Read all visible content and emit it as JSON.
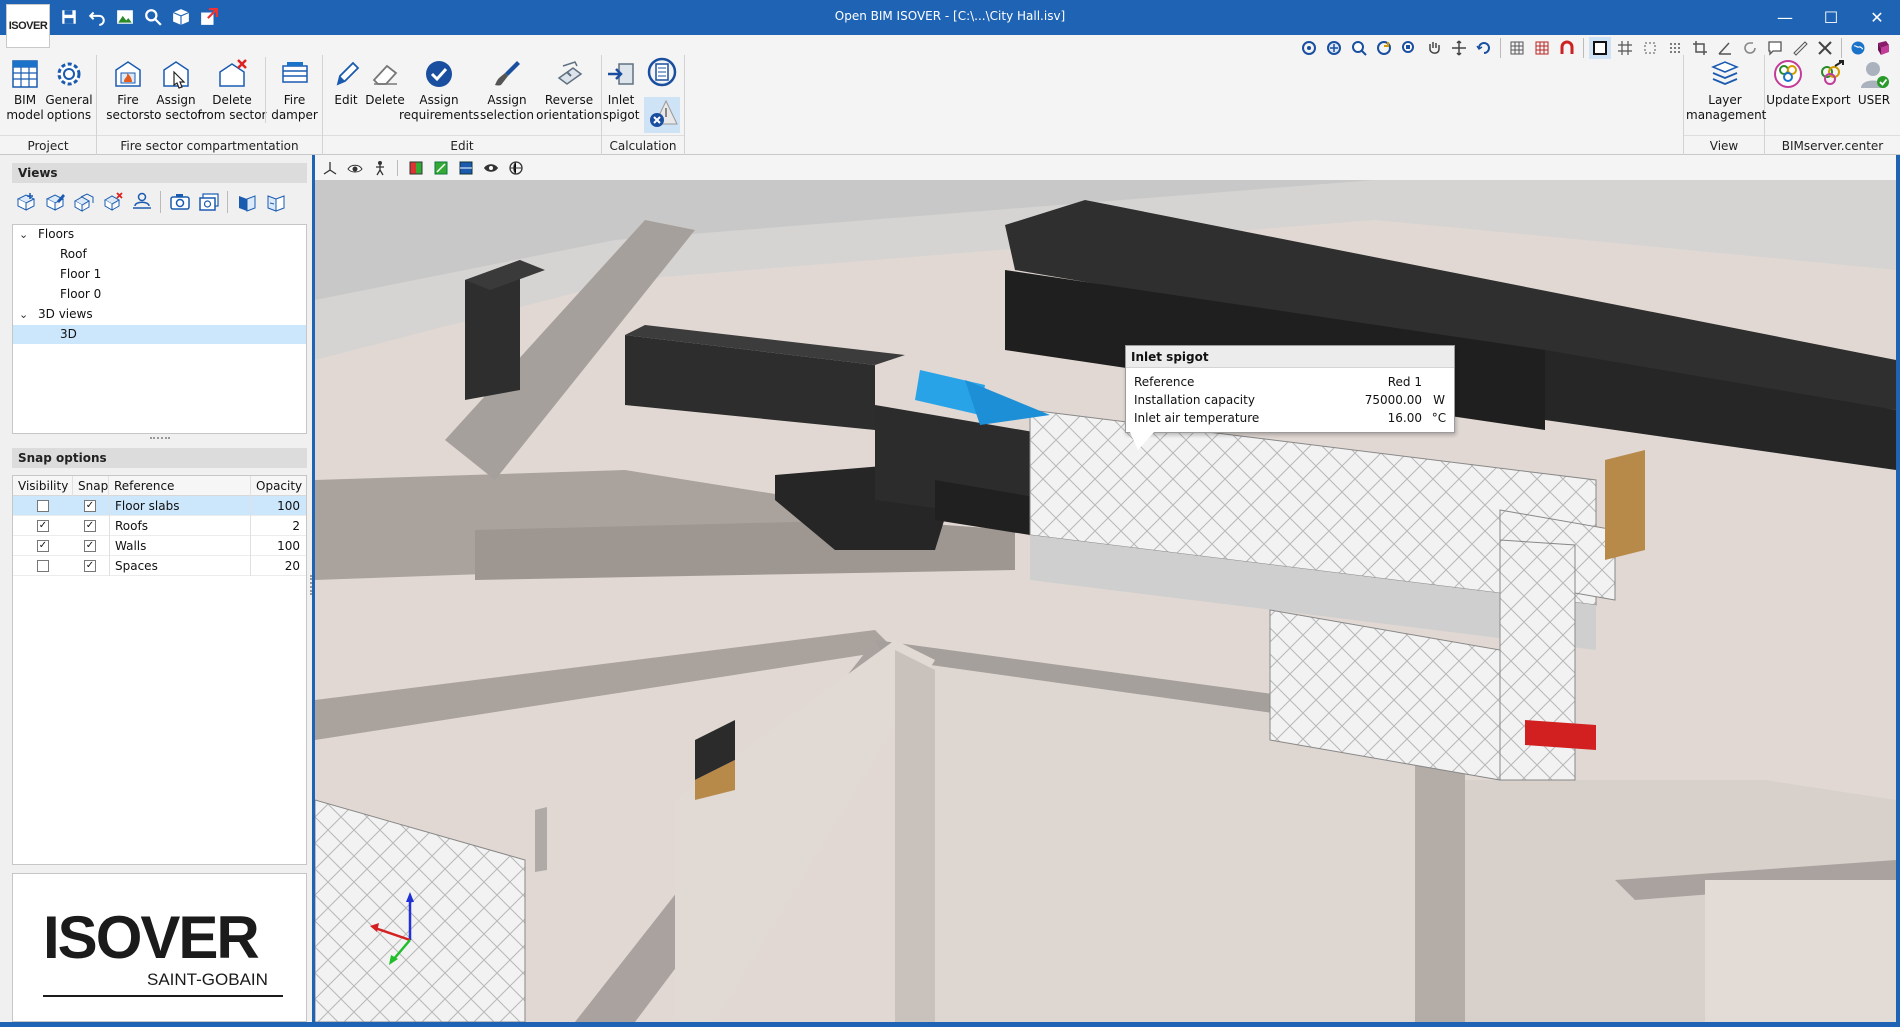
{
  "app": {
    "logo_text": "ISOVER",
    "window_title": "Open BIM ISOVER - [C:\\...\\City Hall.isv]"
  },
  "window_controls": {
    "minimize": "—",
    "maximize": "☐",
    "close": "✕"
  },
  "ribbon": {
    "groups": {
      "project": {
        "label": "Project",
        "bim_model_l1": "BIM",
        "bim_model_l2": "model",
        "general_l1": "General",
        "general_l2": "options"
      },
      "fire": {
        "label": "Fire sector compartmentation",
        "fire_sectors_l1": "Fire",
        "fire_sectors_l2": "sectors",
        "assign_sector_l1": "Assign",
        "assign_sector_l2": "to sector",
        "delete_sector_l1": "Delete",
        "delete_sector_l2": "from sector",
        "fire_damper_l1": "Fire",
        "fire_damper_l2": "damper"
      },
      "edit": {
        "label": "Edit",
        "edit": "Edit",
        "delete": "Delete",
        "assign_req_l1": "Assign",
        "assign_req_l2": "requirements",
        "assign_sel_l1": "Assign",
        "assign_sel_l2": "selection",
        "reverse_l1": "Reverse",
        "reverse_l2": "orientation"
      },
      "calculation": {
        "label": "Calculation",
        "inlet_l1": "Inlet",
        "inlet_l2": "spigot"
      },
      "view": {
        "label": "View",
        "layer_l1": "Layer",
        "layer_l2": "management"
      },
      "bimserver": {
        "label": "BIMserver.center",
        "update": "Update",
        "export": "Export",
        "user": "USER"
      }
    }
  },
  "views_panel": {
    "title": "Views",
    "tree": [
      {
        "label": "Floors",
        "caret": "⌄"
      },
      {
        "label": "Roof"
      },
      {
        "label": "Floor 1"
      },
      {
        "label": "Floor 0"
      },
      {
        "label": "3D views",
        "caret": "⌄"
      },
      {
        "label": "3D"
      }
    ]
  },
  "snap_panel": {
    "title": "Snap options",
    "headers": {
      "visibility": "Visibility",
      "snap": "Snap",
      "reference": "Reference",
      "opacity": "Opacity"
    },
    "rows": [
      {
        "reference": "Floor slabs",
        "opacity": "100",
        "visible": "",
        "snap": "✓"
      },
      {
        "reference": "Roofs",
        "opacity": "2",
        "visible": "✓",
        "snap": "✓"
      },
      {
        "reference": "Walls",
        "opacity": "100",
        "visible": "✓",
        "snap": "✓"
      },
      {
        "reference": "Spaces",
        "opacity": "20",
        "visible": "",
        "snap": "✓"
      }
    ]
  },
  "brand": {
    "name": "ISOVER",
    "subtitle": "SAINT-GOBAIN"
  },
  "tooltip": {
    "title": "Inlet spigot",
    "rows": [
      {
        "label": "Reference",
        "value": "Red 1",
        "unit": ""
      },
      {
        "label": "Installation capacity",
        "value": "75000.00",
        "unit": "W"
      },
      {
        "label": "Inlet air  temperature",
        "value": "16.00",
        "unit": "°C"
      }
    ]
  },
  "colors": {
    "titlebar": "#1e63b4",
    "accent_blue": "#1a73c8",
    "duct_dark": "#2e2e2e",
    "selection": "#cce6fb"
  }
}
